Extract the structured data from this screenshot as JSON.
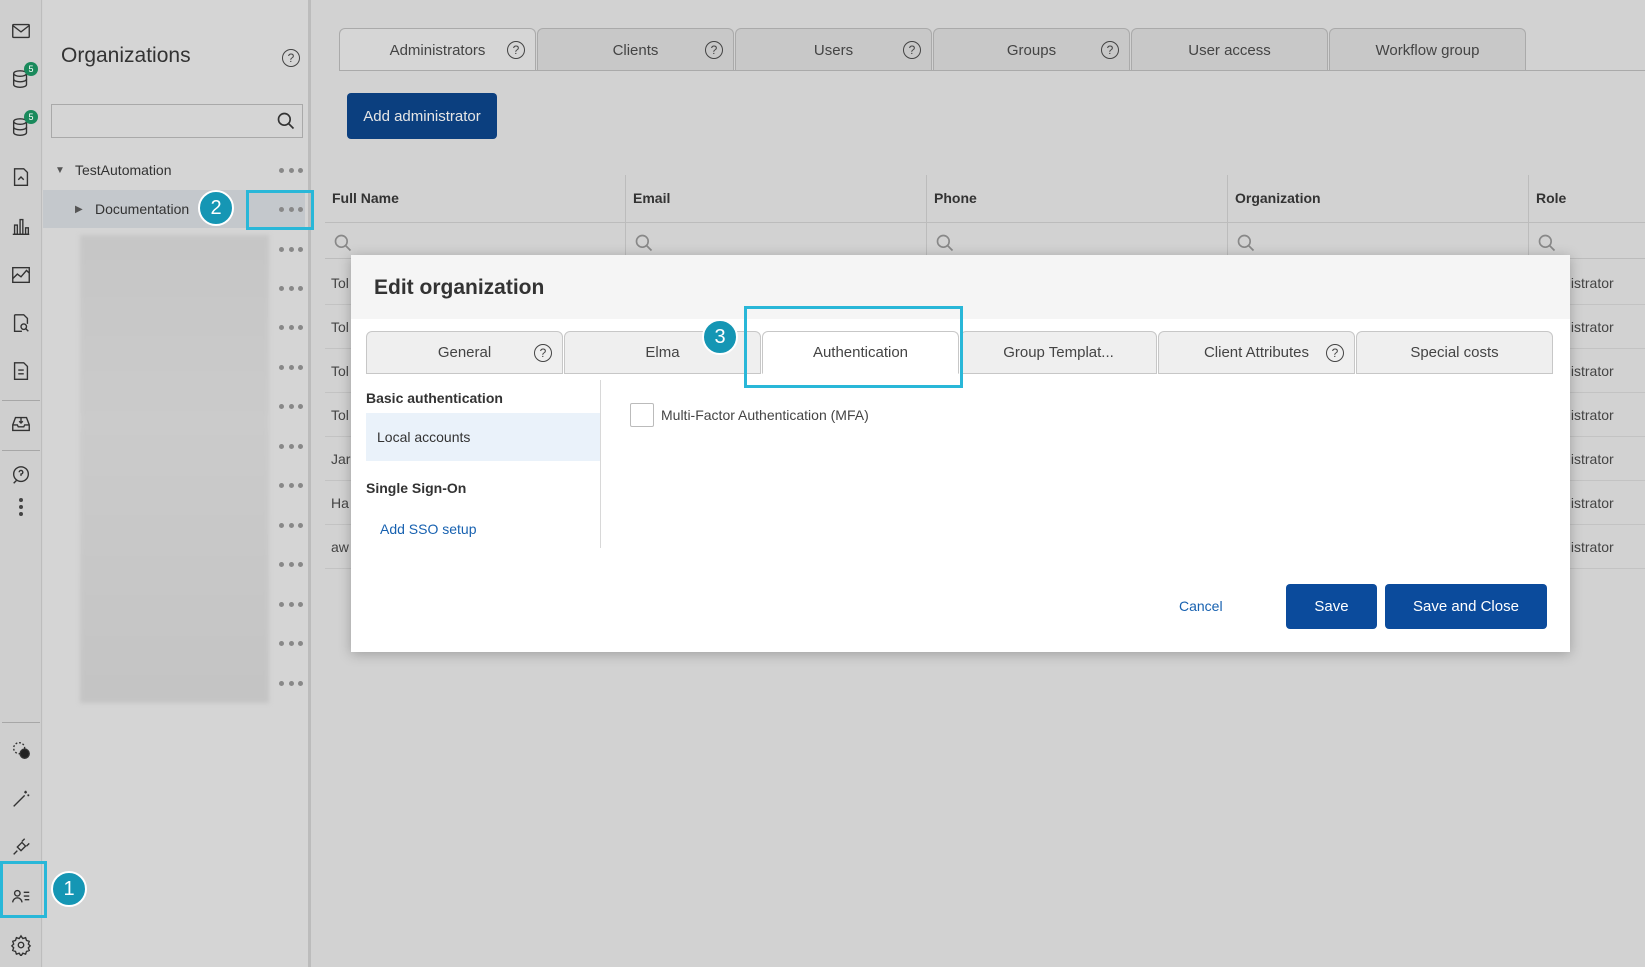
{
  "rail": {
    "icons": [
      "mail-icon",
      "database-icon",
      "database-icon",
      "document-icon",
      "bar-chart-icon",
      "line-chart-icon",
      "search-document-icon",
      "invoice-icon",
      "inbox-download-icon",
      "help-icon",
      "more-icon",
      "cog-ui-icon",
      "magic-wand-icon",
      "plugin-icon",
      "users-list-icon",
      "settings-icon"
    ],
    "badge_1": "5",
    "badge_2": "5"
  },
  "organizations": {
    "title": "Organizations",
    "help": "?",
    "search_placeholder": "",
    "tree": [
      {
        "label": "TestAutomation"
      },
      {
        "label": "Documentation"
      }
    ]
  },
  "main": {
    "tabs": [
      {
        "label": "Administrators",
        "help": "?"
      },
      {
        "label": "Clients",
        "help": "?"
      },
      {
        "label": "Users",
        "help": "?"
      },
      {
        "label": "Groups",
        "help": "?"
      },
      {
        "label": "User access"
      },
      {
        "label": "Workflow group"
      }
    ],
    "add_button": "Add administrator",
    "grid": {
      "columns": [
        "Full Name",
        "Email",
        "Phone",
        "Organization",
        "Role"
      ],
      "rows": [
        {
          "name": "Tol",
          "role": "inistrator"
        },
        {
          "name": "Tol",
          "role": "inistrator"
        },
        {
          "name": "Tol",
          "role": "inistrator"
        },
        {
          "name": "Tol",
          "role": "inistrator"
        },
        {
          "name": "Jar",
          "role": "inistrator"
        },
        {
          "name": "Ha",
          "role": "inistrator"
        },
        {
          "name": "aw",
          "role": "inistrator"
        }
      ]
    }
  },
  "modal": {
    "title": "Edit organization",
    "tabs": [
      {
        "label": "General",
        "help": "?"
      },
      {
        "label": "Elma"
      },
      {
        "label": "Authentication"
      },
      {
        "label": "Group Templat..."
      },
      {
        "label": "Client Attributes",
        "help": "?"
      },
      {
        "label": "Special costs"
      }
    ],
    "side": {
      "basic_heading": "Basic authentication",
      "local_accounts": "Local accounts",
      "sso_heading": "Single Sign-On",
      "add_sso": "Add SSO setup"
    },
    "mfa_label": "Multi-Factor Authentication (MFA)",
    "mfa_checked": false,
    "cancel": "Cancel",
    "save": "Save",
    "save_close": "Save and Close"
  },
  "markers": [
    "1",
    "2",
    "3"
  ],
  "colors": {
    "primary": "#0b4b9c",
    "highlight": "#29b7d8",
    "marker": "#1596b4",
    "link": "#1761b0"
  }
}
